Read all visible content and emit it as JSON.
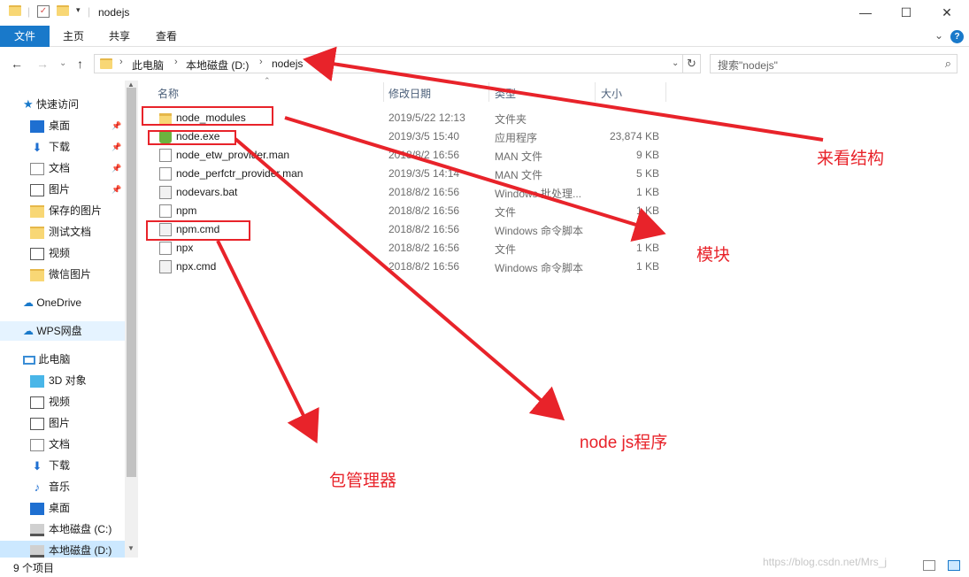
{
  "window": {
    "title": "nodejs",
    "minimize": "—",
    "maximize": "☐",
    "close": "✕"
  },
  "ribbon": {
    "tabs": [
      "文件",
      "主页",
      "共享",
      "查看"
    ],
    "help": "?"
  },
  "address": {
    "crumbs": [
      "此电脑",
      "本地磁盘 (D:)",
      "nodejs"
    ],
    "search_placeholder": "搜索\"nodejs\""
  },
  "sidebar": {
    "quick_access": "快速访问",
    "items": [
      {
        "label": "桌面",
        "icon": "desktop-icon",
        "pinned": true
      },
      {
        "label": "下载",
        "icon": "download-icon",
        "pinned": true
      },
      {
        "label": "文档",
        "icon": "document-icon",
        "pinned": true
      },
      {
        "label": "图片",
        "icon": "picture-icon",
        "pinned": true
      },
      {
        "label": "保存的图片",
        "icon": "folder-icon",
        "pinned": false
      },
      {
        "label": "测试文档",
        "icon": "folder-icon",
        "pinned": false
      },
      {
        "label": "视频",
        "icon": "video-icon",
        "pinned": false
      },
      {
        "label": "微信图片",
        "icon": "folder-icon",
        "pinned": false
      }
    ],
    "onedrive": "OneDrive",
    "wps": "WPS网盘",
    "this_pc": "此电脑",
    "pc_items": [
      {
        "label": "3D 对象",
        "icon": "3d-objects-icon"
      },
      {
        "label": "视频",
        "icon": "video-icon"
      },
      {
        "label": "图片",
        "icon": "picture-icon"
      },
      {
        "label": "文档",
        "icon": "document-icon"
      },
      {
        "label": "下载",
        "icon": "download-icon"
      },
      {
        "label": "音乐",
        "icon": "music-icon"
      },
      {
        "label": "桌面",
        "icon": "desktop-icon"
      },
      {
        "label": "本地磁盘 (C:)",
        "icon": "drive-icon"
      },
      {
        "label": "本地磁盘 (D:)",
        "icon": "drive-icon"
      }
    ]
  },
  "columns": [
    "名称",
    "修改日期",
    "类型",
    "大小"
  ],
  "files": [
    {
      "name": "node_modules",
      "date": "2019/5/22 12:13",
      "type": "文件夹",
      "size": "",
      "icon": "folder-icon"
    },
    {
      "name": "node.exe",
      "date": "2019/3/5 15:40",
      "type": "应用程序",
      "size": "23,874 KB",
      "icon": "node-exe-icon"
    },
    {
      "name": "node_etw_provider.man",
      "date": "2018/8/2 16:56",
      "type": "MAN 文件",
      "size": "9 KB",
      "icon": "file-icon"
    },
    {
      "name": "node_perfctr_provider.man",
      "date": "2019/3/5 14:14",
      "type": "MAN 文件",
      "size": "5 KB",
      "icon": "file-icon"
    },
    {
      "name": "nodevars.bat",
      "date": "2018/8/2 16:56",
      "type": "Windows 批处理...",
      "size": "1 KB",
      "icon": "script-icon"
    },
    {
      "name": "npm",
      "date": "2018/8/2 16:56",
      "type": "文件",
      "size": "1 KB",
      "icon": "file-icon"
    },
    {
      "name": "npm.cmd",
      "date": "2018/8/2 16:56",
      "type": "Windows 命令脚本",
      "size": "1 KB",
      "icon": "script-icon"
    },
    {
      "name": "npx",
      "date": "2018/8/2 16:56",
      "type": "文件",
      "size": "1 KB",
      "icon": "file-icon"
    },
    {
      "name": "npx.cmd",
      "date": "2018/8/2 16:56",
      "type": "Windows 命令脚本",
      "size": "1 KB",
      "icon": "script-icon"
    }
  ],
  "status": "9 个项目",
  "watermark": "https://blog.csdn.net/Mrs_j",
  "annotations": {
    "structure": "来看结构",
    "modules": "模块",
    "program": "node js程序",
    "pkg_manager": "包管理器"
  },
  "colors": {
    "accent": "#1979ca",
    "annotation": "#e8232a"
  }
}
